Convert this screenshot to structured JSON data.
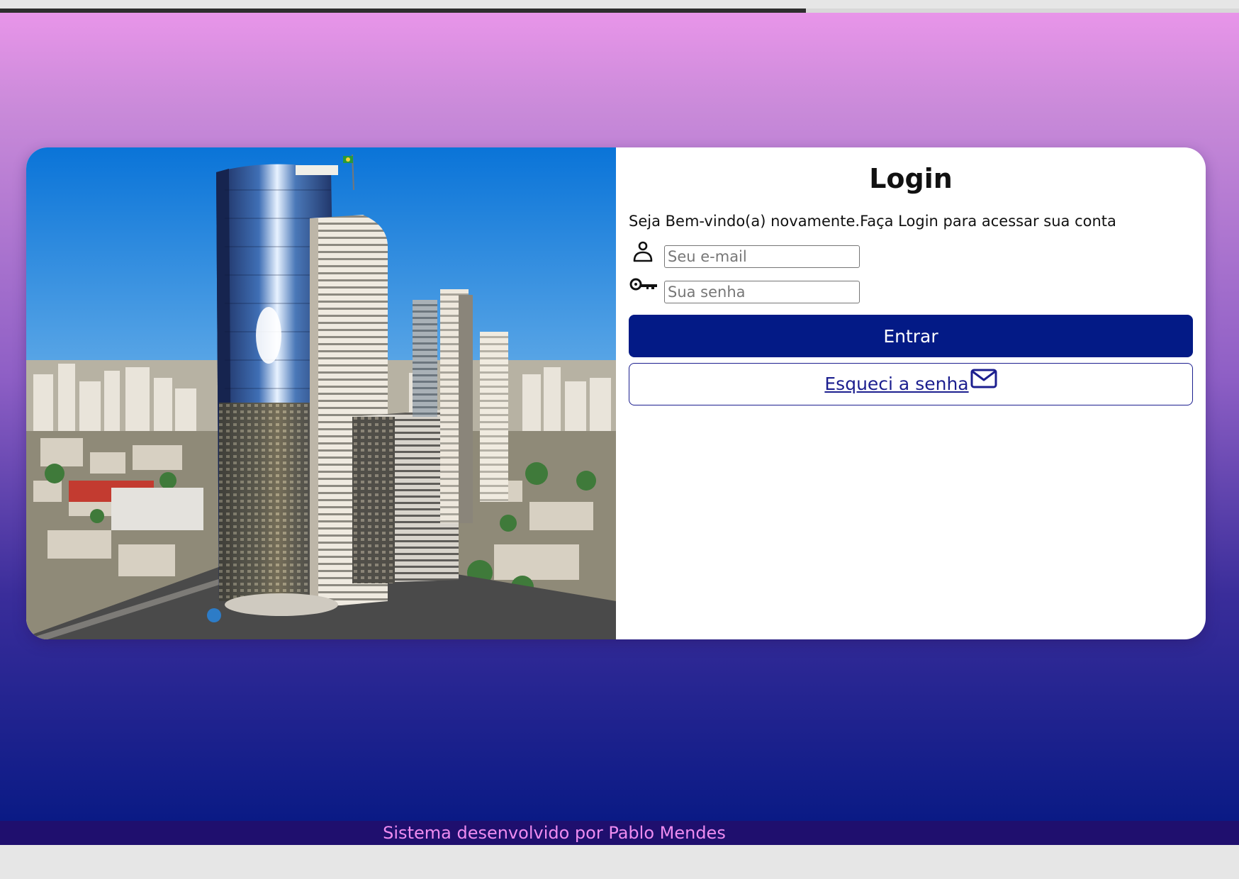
{
  "login": {
    "title": "Login",
    "welcome": "Seja Bem-vindo(a) novamente.Faça Login para acessar sua conta",
    "email_placeholder": "Seu e-mail",
    "password_placeholder": "Sua senha",
    "submit_label": "Entrar",
    "forgot_label": "Esqueci a senha"
  },
  "footer": {
    "text": "Sistema desenvolvido por Pablo Mendes"
  },
  "icons": {
    "user": "user-icon",
    "key": "key-icon",
    "mail": "mail-icon"
  },
  "colors": {
    "primary": "#031a86",
    "link": "#1c1f8f",
    "footer_bg": "#1f0f6e",
    "footer_text": "#ee8cf0",
    "bg_top": "#e895e9",
    "bg_bottom": "#0a1a85"
  }
}
